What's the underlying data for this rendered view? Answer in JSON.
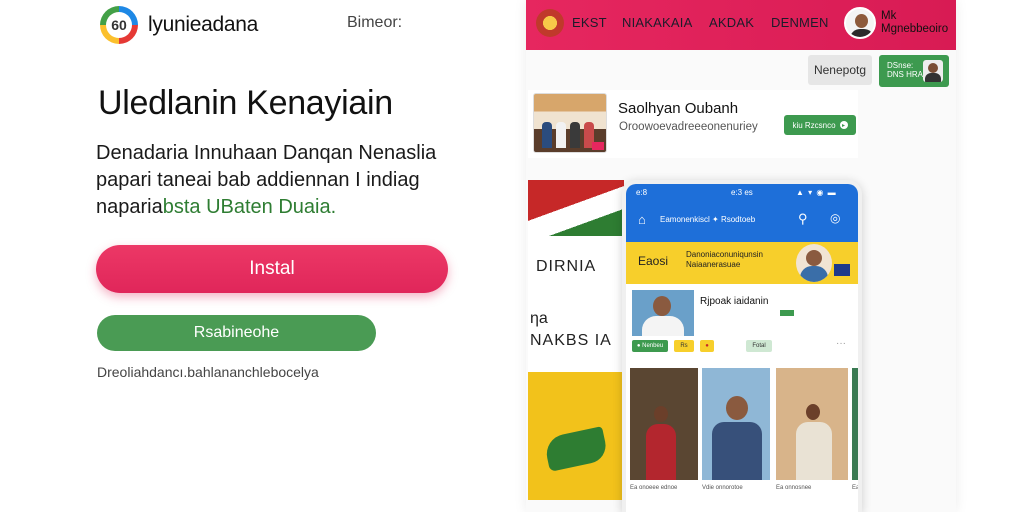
{
  "promo": {
    "brand_logo_text": "60",
    "brand_name": "lyunieadana",
    "top_link": "Bimeor:",
    "headline": "Uledlanin Kenayiain",
    "description_line1": "Denadaria Innuhaan Danqan Nenaslia",
    "description_line2": "papari taneai bab addiennan I indiag",
    "description_line3_a": "naparia",
    "description_line3_b": "bsta UBaten Duaia.",
    "install_button": "Instal",
    "secondary_button": "Rsabineohe",
    "footnote": "Dreoliahdancı.bahlananchlebocelya"
  },
  "app": {
    "nav": {
      "items": [
        "EKST",
        "NIAKAKAIA",
        "AKDAK",
        "DENMEN"
      ],
      "profile_line1": "Mk",
      "profile_line2": "Mgnebbeoiro",
      "emblem_icon": "garuda-emblem-icon"
    },
    "toolbar": {
      "search_button": "Nenepotg",
      "green_button_line1": "DSnse:",
      "green_button_line2": "DNS HRA"
    },
    "featured": {
      "title": "Saolhyan Oubanh",
      "subtitle": "Oroowoevadreeeonenuriey",
      "button": "kiu Rzcsnco"
    },
    "promo_side": {
      "text1": "DIRNIA",
      "text2": "ƞa",
      "text3": "NAKBS IA"
    },
    "phone": {
      "status_left": "e:8",
      "status_time": "e:3 es",
      "status_icons": "▲ ▾ ◉ ▬",
      "app_title": "Eamonenkiscl ✦ Rsodtoeb",
      "banner_left": "Eaosi",
      "banner_text": "Danoniaconuniqunsin Naiaanerasuae",
      "post_title": "Rjpoak iaidanin",
      "post_sub": "",
      "chips": [
        "● Nenbeu",
        "Rs",
        "●",
        "Fotal"
      ],
      "captions": [
        "Ea onoeee ednoe",
        "Vdie onnorotoe",
        "Ea onnosnee",
        "Ea"
      ]
    },
    "colors": {
      "brand_pink": "#e6275f",
      "brand_green": "#3d9a4f",
      "phone_blue": "#1e6fd9",
      "banner_yellow": "#f7cf2b"
    }
  }
}
